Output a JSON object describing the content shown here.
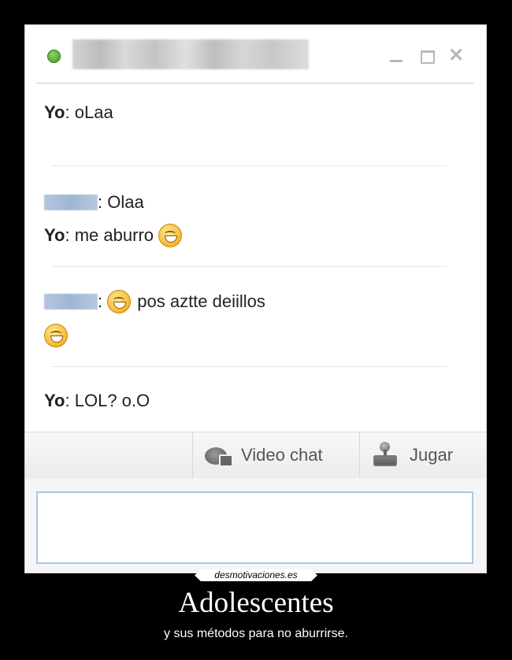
{
  "chat": {
    "messages": [
      {
        "sender": "Yo",
        "text": "oLaa"
      },
      {
        "text": "Olaa"
      },
      {
        "sender": "Yo",
        "text": "me aburro"
      },
      {
        "text": "pos aztte deiillos"
      },
      {
        "sender": "Yo",
        "text": "LOL? o.O"
      }
    ],
    "separator": ":"
  },
  "toolbar": {
    "video_chat_label": "Video chat",
    "play_label": "Jugar"
  },
  "icons": {
    "status": "online-status-dot",
    "smiley": "laughing-smiley-icon",
    "video": "video-camera-icon",
    "game": "joystick-icon"
  },
  "watermark": "desmotivaciones.es",
  "caption": {
    "title": "Adolescentes",
    "subtitle": "y sus métodos para no aburrirse."
  }
}
